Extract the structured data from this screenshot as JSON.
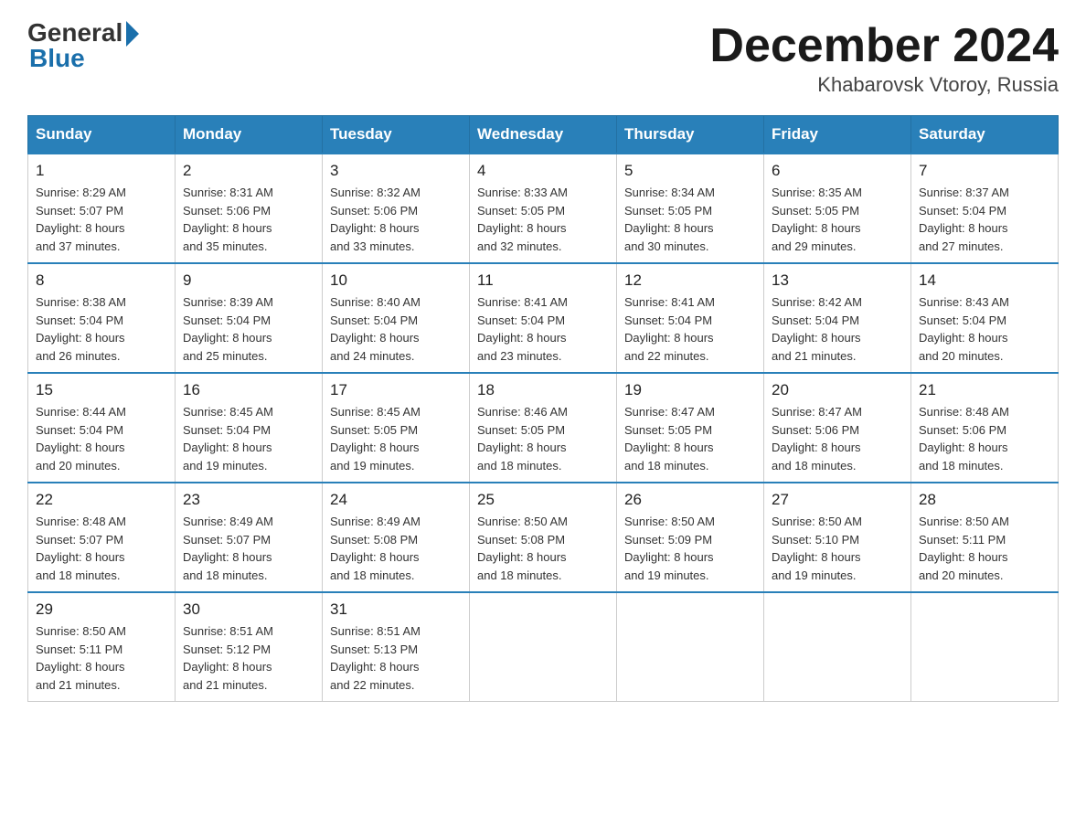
{
  "header": {
    "logo_general": "General",
    "logo_blue": "Blue",
    "month_title": "December 2024",
    "location": "Khabarovsk Vtoroy, Russia"
  },
  "weekdays": [
    "Sunday",
    "Monday",
    "Tuesday",
    "Wednesday",
    "Thursday",
    "Friday",
    "Saturday"
  ],
  "weeks": [
    [
      {
        "day": "1",
        "sunrise": "8:29 AM",
        "sunset": "5:07 PM",
        "daylight": "8 hours and 37 minutes."
      },
      {
        "day": "2",
        "sunrise": "8:31 AM",
        "sunset": "5:06 PM",
        "daylight": "8 hours and 35 minutes."
      },
      {
        "day": "3",
        "sunrise": "8:32 AM",
        "sunset": "5:06 PM",
        "daylight": "8 hours and 33 minutes."
      },
      {
        "day": "4",
        "sunrise": "8:33 AM",
        "sunset": "5:05 PM",
        "daylight": "8 hours and 32 minutes."
      },
      {
        "day": "5",
        "sunrise": "8:34 AM",
        "sunset": "5:05 PM",
        "daylight": "8 hours and 30 minutes."
      },
      {
        "day": "6",
        "sunrise": "8:35 AM",
        "sunset": "5:05 PM",
        "daylight": "8 hours and 29 minutes."
      },
      {
        "day": "7",
        "sunrise": "8:37 AM",
        "sunset": "5:04 PM",
        "daylight": "8 hours and 27 minutes."
      }
    ],
    [
      {
        "day": "8",
        "sunrise": "8:38 AM",
        "sunset": "5:04 PM",
        "daylight": "8 hours and 26 minutes."
      },
      {
        "day": "9",
        "sunrise": "8:39 AM",
        "sunset": "5:04 PM",
        "daylight": "8 hours and 25 minutes."
      },
      {
        "day": "10",
        "sunrise": "8:40 AM",
        "sunset": "5:04 PM",
        "daylight": "8 hours and 24 minutes."
      },
      {
        "day": "11",
        "sunrise": "8:41 AM",
        "sunset": "5:04 PM",
        "daylight": "8 hours and 23 minutes."
      },
      {
        "day": "12",
        "sunrise": "8:41 AM",
        "sunset": "5:04 PM",
        "daylight": "8 hours and 22 minutes."
      },
      {
        "day": "13",
        "sunrise": "8:42 AM",
        "sunset": "5:04 PM",
        "daylight": "8 hours and 21 minutes."
      },
      {
        "day": "14",
        "sunrise": "8:43 AM",
        "sunset": "5:04 PM",
        "daylight": "8 hours and 20 minutes."
      }
    ],
    [
      {
        "day": "15",
        "sunrise": "8:44 AM",
        "sunset": "5:04 PM",
        "daylight": "8 hours and 20 minutes."
      },
      {
        "day": "16",
        "sunrise": "8:45 AM",
        "sunset": "5:04 PM",
        "daylight": "8 hours and 19 minutes."
      },
      {
        "day": "17",
        "sunrise": "8:45 AM",
        "sunset": "5:05 PM",
        "daylight": "8 hours and 19 minutes."
      },
      {
        "day": "18",
        "sunrise": "8:46 AM",
        "sunset": "5:05 PM",
        "daylight": "8 hours and 18 minutes."
      },
      {
        "day": "19",
        "sunrise": "8:47 AM",
        "sunset": "5:05 PM",
        "daylight": "8 hours and 18 minutes."
      },
      {
        "day": "20",
        "sunrise": "8:47 AM",
        "sunset": "5:06 PM",
        "daylight": "8 hours and 18 minutes."
      },
      {
        "day": "21",
        "sunrise": "8:48 AM",
        "sunset": "5:06 PM",
        "daylight": "8 hours and 18 minutes."
      }
    ],
    [
      {
        "day": "22",
        "sunrise": "8:48 AM",
        "sunset": "5:07 PM",
        "daylight": "8 hours and 18 minutes."
      },
      {
        "day": "23",
        "sunrise": "8:49 AM",
        "sunset": "5:07 PM",
        "daylight": "8 hours and 18 minutes."
      },
      {
        "day": "24",
        "sunrise": "8:49 AM",
        "sunset": "5:08 PM",
        "daylight": "8 hours and 18 minutes."
      },
      {
        "day": "25",
        "sunrise": "8:50 AM",
        "sunset": "5:08 PM",
        "daylight": "8 hours and 18 minutes."
      },
      {
        "day": "26",
        "sunrise": "8:50 AM",
        "sunset": "5:09 PM",
        "daylight": "8 hours and 19 minutes."
      },
      {
        "day": "27",
        "sunrise": "8:50 AM",
        "sunset": "5:10 PM",
        "daylight": "8 hours and 19 minutes."
      },
      {
        "day": "28",
        "sunrise": "8:50 AM",
        "sunset": "5:11 PM",
        "daylight": "8 hours and 20 minutes."
      }
    ],
    [
      {
        "day": "29",
        "sunrise": "8:50 AM",
        "sunset": "5:11 PM",
        "daylight": "8 hours and 21 minutes."
      },
      {
        "day": "30",
        "sunrise": "8:51 AM",
        "sunset": "5:12 PM",
        "daylight": "8 hours and 21 minutes."
      },
      {
        "day": "31",
        "sunrise": "8:51 AM",
        "sunset": "5:13 PM",
        "daylight": "8 hours and 22 minutes."
      },
      null,
      null,
      null,
      null
    ]
  ]
}
